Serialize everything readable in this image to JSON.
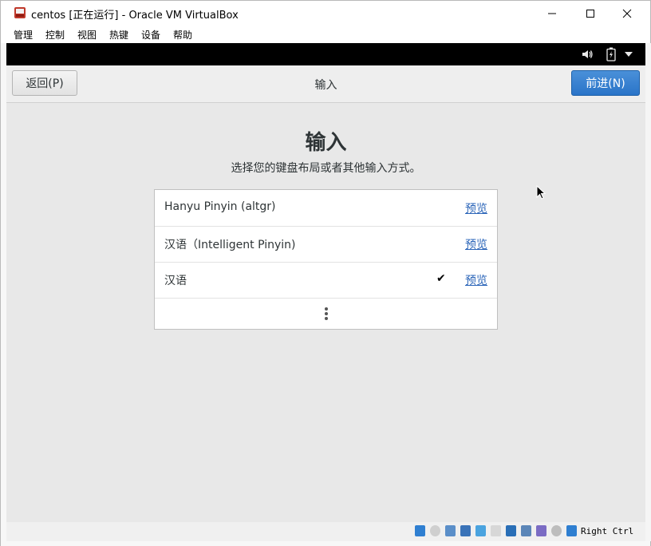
{
  "window": {
    "title": "centos [正在运行] - Oracle VM VirtualBox",
    "controls": {
      "minimize": "minimize-icon",
      "maximize": "maximize-icon",
      "close": "close-icon"
    }
  },
  "menu": {
    "items": [
      "管理",
      "控制",
      "视图",
      "热键",
      "设备",
      "帮助"
    ]
  },
  "vm_topbar": {
    "icons": [
      "volume-icon",
      "battery-icon",
      "chevron-down-icon"
    ]
  },
  "header": {
    "back_label": "返回(P)",
    "title": "输入",
    "next_label": "前进(N)"
  },
  "page": {
    "title": "输入",
    "subtitle": "选择您的键盘布局或者其他输入方式。"
  },
  "inputs": [
    {
      "label": "Hanyu Pinyin (altgr)",
      "link": "预览",
      "selected": false
    },
    {
      "label": "汉语（Intelligent Pinyin)",
      "link": "预览",
      "selected": false
    },
    {
      "label": "汉语",
      "link": "预览",
      "selected": true
    }
  ],
  "status": {
    "host_key": "Right Ctrl"
  },
  "colors": {
    "accent": "#2a74c8",
    "link": "#2a64b8",
    "titlebar": "#ffffff",
    "vm_bg": "#e8e8e8"
  }
}
